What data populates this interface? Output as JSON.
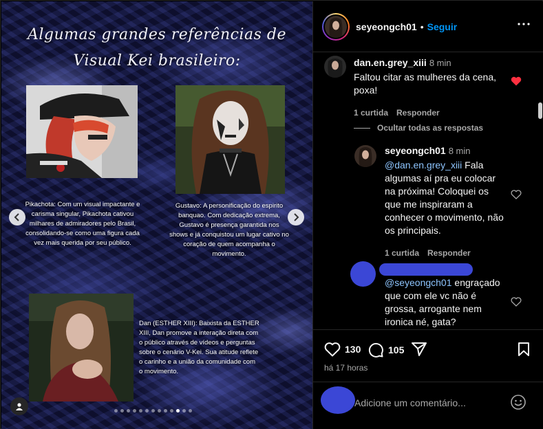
{
  "post": {
    "title_line1": "Algumas grandes referências de",
    "title_line2": "Visual Kei brasileiro:",
    "captions": [
      "Pikachota: Com um visual impactante e carisma singular, Pikachota cativou milhares de admiradores pelo Brasil, consolidando-se como uma figura cada vez mais querida por seu público.",
      "Gustavo: A personificação do espirito banquao. Com dedicação extrema, Gustavo é presença garantida nos shows e já conquistou um lugar cativo no coração de quem acompanha o movimento.",
      "Dan (ESTHER XIII): Baixista da ESTHER XIII, Dan promove a interação direta com o público através de vídeos e perguntas sobre o cenário V-Kei. Sua atitude reflete o carinho e a união da comunidade com o movimento."
    ],
    "carousel": {
      "total": 13,
      "active_index": 10
    }
  },
  "header": {
    "username": "seyeongch01",
    "separator": "•",
    "follow_label": "Seguir"
  },
  "comments": [
    {
      "username": "dan.en.grey_xiii",
      "time": "8 min",
      "text_line1": "Faltou citar as mulheres da cena,",
      "text_line2": "poxa!",
      "likes": "1 curtida",
      "reply_label": "Responder",
      "liked": true
    }
  ],
  "replies_toggle": "Ocultar todas as respostas",
  "replies": [
    {
      "username": "seyeongch01",
      "time": "8 min",
      "mention": "@dan.en.grey_xiii",
      "lines": [
        "Fala",
        "algumas aí pra eu colocar",
        "na próxima! Coloquei os",
        "que me inspiraram a",
        "conhecer o movimento, não",
        "os principais."
      ],
      "likes": "1 curtida",
      "reply_label": "Responder"
    },
    {
      "username": "",
      "mention": "@seyeongch01",
      "lines": [
        "engraçado",
        "que com ele vc não é",
        "grossa, arrogante nem",
        "ironica né, gata?"
      ]
    }
  ],
  "actions": {
    "likes": "130",
    "comments": "105",
    "posted": "há 17 horas"
  },
  "add_comment": {
    "placeholder": "Adicione um comentário..."
  },
  "colors": {
    "accent": "#0095f6",
    "liked_heart": "#ff3040",
    "redaction": "#3b47d6"
  }
}
